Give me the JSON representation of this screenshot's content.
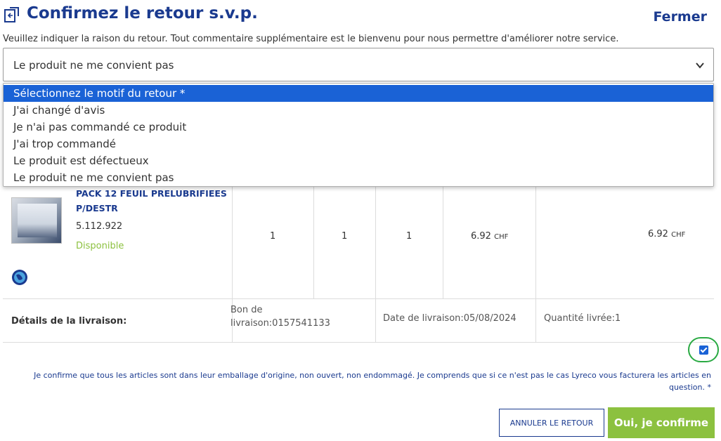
{
  "dialog": {
    "title": "Confirmez le retour s.v.p.",
    "close_label": "Fermer",
    "instruction": "Veuillez indiquer la raison du retour. Tout commentaire supplémentaire est le bienvenu pour nous permettre d'améliorer notre service."
  },
  "reason_select": {
    "selected": "Le produit ne me convient pas",
    "options": [
      "Sélectionnez le motif du retour *",
      "J'ai changé d'avis",
      "Je n'ai pas commandé ce produit",
      "J'ai trop commandé",
      "Le produit est défectueux",
      "Le produit ne me convient pas"
    ],
    "highlighted_index": 0
  },
  "product": {
    "name": "PACK 12 FEUIL PRELUBRIFIEES P/DESTR",
    "reference": "5.112.922",
    "availability": "Disponible",
    "qty1": "1",
    "qty2": "1",
    "qty3": "1",
    "unit_price": "6.92",
    "total_price": "6.92",
    "currency": "CHF"
  },
  "delivery": {
    "label": "Détails de la livraison:",
    "bon": "Bon de livraison:0157541133",
    "date": "Date de livraison:05/08/2024",
    "qty": "Quantité livrée:1"
  },
  "confirmation": {
    "checked": true,
    "text": "Je confirme que tous les articles sont dans leur emballage d'origine, non ouvert, non endommagé. Je comprends que si ce n'est pas le cas Lyreco vous facturera les articles en question. *"
  },
  "buttons": {
    "cancel": "ANNULER LE RETOUR",
    "confirm": "Oui, je confirme"
  },
  "colors": {
    "brand_blue": "#1a3a8f",
    "select_highlight": "#1a62d6",
    "green": "#8cc13f",
    "annotation_circle": "#2aaa43"
  }
}
